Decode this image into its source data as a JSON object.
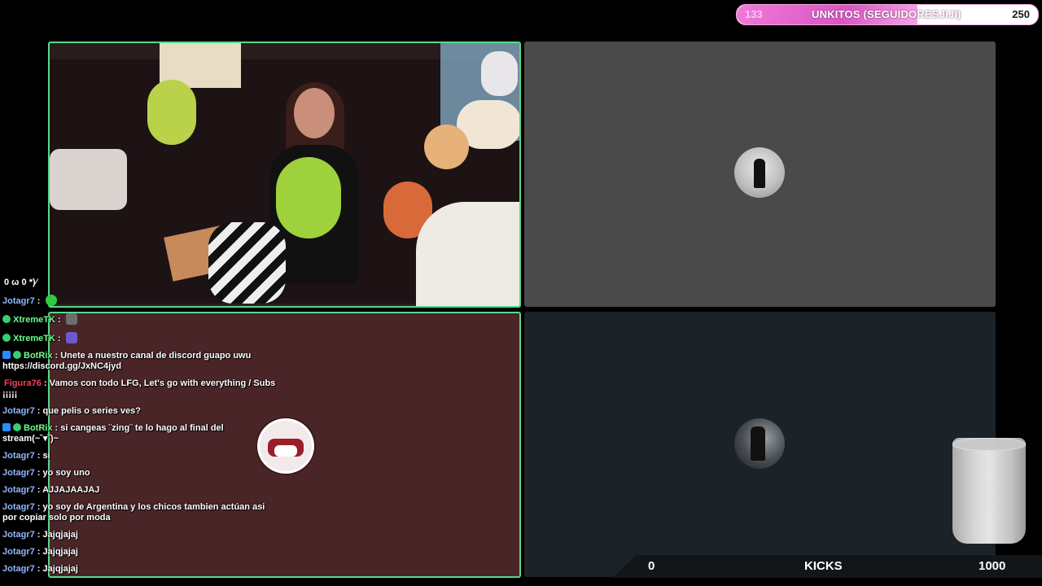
{
  "goal": {
    "current": "133",
    "title": "UNKITOS (SEGUIDORESJIJI)",
    "max": "250",
    "fill_fraction": 0.6
  },
  "kicks": {
    "current": "0",
    "label": "KICKS",
    "max": "1000"
  },
  "colors": {
    "panel_border": "#57d98a",
    "chat_bg": "#4a2528",
    "goal_pink": "#d957c2"
  },
  "chat": {
    "messages": [
      {
        "user": "",
        "text": "0 ω 0 *)⁄",
        "color": "white"
      },
      {
        "user": "Jotagr7",
        "text": " : ",
        "emote": "smile-emote"
      },
      {
        "user": "XtremeTK",
        "text": " : ",
        "emote": "kick-emote",
        "badge": "verified"
      },
      {
        "user": "XtremeTK",
        "text": " : ",
        "emote": "purple-emote",
        "badge": "verified"
      },
      {
        "user": "BotRix",
        "text": " : Unete a nuestro canal de discord guapo uwu https://discord.gg/JxNC4jyd",
        "badge": "bot"
      },
      {
        "user": "Figura76",
        "text": " : Vamos con todo LFG, Let's go with everything / Subs ¡¡¡¡¡"
      },
      {
        "user": "Jotagr7",
        "text": " : que pelis o series ves?"
      },
      {
        "user": "BotRix",
        "text": " : si cangeas ¨zing¨ te lo hago al final del stream(~˘▾˘)~",
        "badge": "bot"
      },
      {
        "user": "Jotagr7",
        "text": " : si"
      },
      {
        "user": "Jotagr7",
        "text": " : yo soy uno"
      },
      {
        "user": "Jotagr7",
        "text": " : AJJAJAAJAJ"
      },
      {
        "user": "Jotagr7",
        "text": " : yo soy de Argentina y los chicos tambien actúan asi por copiar solo por moda"
      },
      {
        "user": "Jotagr7",
        "text": " : Jajqjajaj"
      },
      {
        "user": "Jotagr7",
        "text": " : Jajqjajaj"
      },
      {
        "user": "Jotagr7",
        "text": " : Jajqjajaj"
      }
    ]
  }
}
